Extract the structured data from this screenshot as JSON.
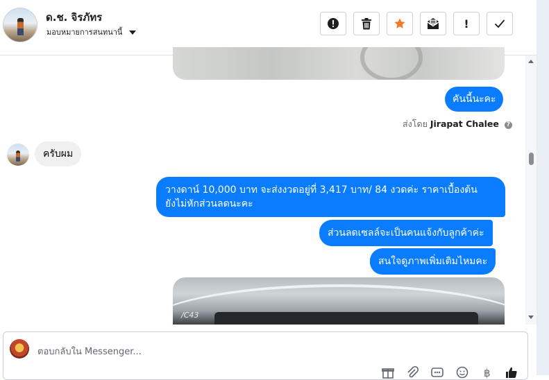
{
  "header": {
    "contact_name": "ด.ช. จิรภัทร",
    "assign_label": "มอบหมายการสนทนานี้",
    "toolbar": [
      {
        "name": "mark-spam-button",
        "icon": "alert-circle-icon"
      },
      {
        "name": "delete-button",
        "icon": "trash-icon"
      },
      {
        "name": "star-button",
        "icon": "star-icon",
        "color": "#f37a2b"
      },
      {
        "name": "mark-unread-button",
        "icon": "envelope-icon"
      },
      {
        "name": "follow-up-button",
        "icon": "exclamation-icon",
        "glyph": "!"
      },
      {
        "name": "mark-done-button",
        "icon": "check-icon"
      }
    ]
  },
  "messages": {
    "m1": "คันนี้นะคะ",
    "sent_by_prefix": "ส่งโดย",
    "sent_by_name": "Jirapat Chalee",
    "m2": "ครับผม",
    "m3_line1": "วางดาน์ 10,000 บาท จะส่งงวดอยู่ที่ 3,417 บาท/ 84 งวดค่ะ ราคาเบื้องต้น",
    "m3_line2": "ยังไม่หักส่วนลดนะคะ",
    "m4": "ส่วนลดเซลล์จะเป็นคนแจ้งกับลูกค้าค่ะ",
    "m5": "สนใจดูภาพเพิ่มเติมไหมคะ",
    "photo_stamp": "/C43"
  },
  "composer": {
    "placeholder": "ตอบกลับใน Messenger...",
    "tools": [
      "gift-icon",
      "attachment-icon",
      "saved-reply-icon",
      "emoji-icon",
      "baht-icon",
      "like-icon"
    ]
  },
  "colors": {
    "outgoing_bubble": "#0a7cff",
    "incoming_bubble": "#f0f0f0",
    "star": "#f37a2b"
  }
}
